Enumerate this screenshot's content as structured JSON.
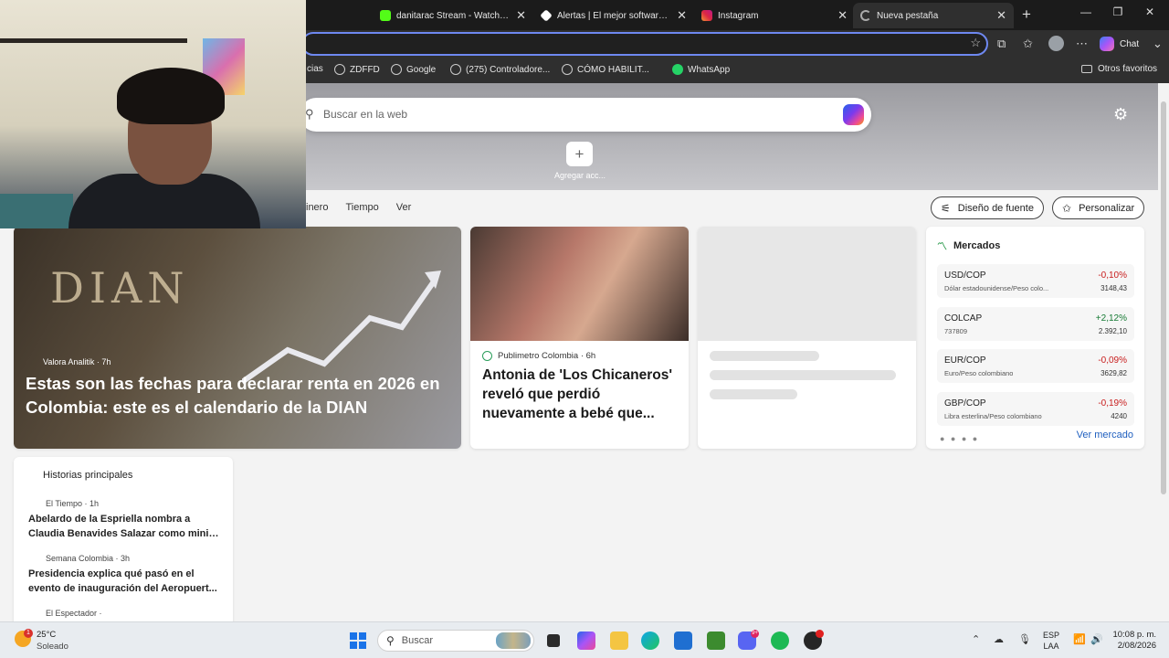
{
  "browser": {
    "tabs": [
      {
        "title": "danitarac Stream - Watch Live",
        "close": "✕",
        "active": false,
        "color": "#53fc18"
      },
      {
        "title": "Alertas | El mejor software para",
        "close": "✕",
        "active": false,
        "color": "#ffffff"
      },
      {
        "title": "Instagram",
        "close": "✕",
        "active": false,
        "color": "#e1306c"
      },
      {
        "title": "Nueva pestaña",
        "close": "✕",
        "active": true,
        "color": "#9aa0a6"
      }
    ],
    "new_tab_symbol": "+",
    "window_controls": {
      "minimize": "—",
      "maximize": "❐",
      "close": "✕"
    },
    "chat_label": "Chat",
    "favorites": [
      {
        "label": "cias",
        "icon": "none"
      },
      {
        "label": "ZDFFD",
        "icon": "globe-icon"
      },
      {
        "label": "Google",
        "icon": "globe-icon"
      },
      {
        "label": "(275) Controladore...",
        "icon": "globe-icon"
      },
      {
        "label": "CÓMO HABILIT...",
        "icon": "globe-icon"
      },
      {
        "label": "WhatsApp",
        "icon": "whatsapp-icon"
      }
    ],
    "other_favorites": "Otros favoritos"
  },
  "ntp": {
    "search_placeholder": "Buscar en la web",
    "add_shortcut": "Agregar acc...",
    "nav": [
      "inero",
      "Tiempo",
      "Ver"
    ],
    "font_design_btn": "Diseño de fuente",
    "personalize_btn": "Personalizar",
    "hero": {
      "source": "Valora Analitik · 7h",
      "title": "Estas son las fechas para declarar renta en 2026 en Colombia: este es el calendario de la DIAN",
      "logo_text": "DIAN"
    },
    "card2": {
      "source": "Publimetro Colombia · 6h",
      "title": "Antonia de 'Los Chicaneros' reveló que perdió nuevamente a bebé que..."
    },
    "markets": {
      "title": "Mercados",
      "rows": [
        {
          "symbol": "USD/COP",
          "name": "Dólar estadounidense/Peso colo...",
          "change": "-0,10%",
          "value": "3148,43",
          "dir": "neg"
        },
        {
          "symbol": "COLCAP",
          "name": "737809",
          "change": "+2,12%",
          "value": "2.392,10",
          "dir": "pos"
        },
        {
          "symbol": "EUR/COP",
          "name": "Euro/Peso colombiano",
          "change": "-0,09%",
          "value": "3629,82",
          "dir": "neg"
        },
        {
          "symbol": "GBP/COP",
          "name": "Libra esterlina/Peso colombiano",
          "change": "-0,19%",
          "value": "4240",
          "dir": "neg"
        }
      ],
      "see_more": "Ver mercado"
    },
    "stories": {
      "title": "Historias principales",
      "items": [
        {
          "source": "El Tiempo · 1h",
          "title_line1": "Abelardo de la Espriella nombra a",
          "title_line2": "Claudia Benavides Salazar como minist..."
        },
        {
          "source": "Semana Colombia · 3h",
          "title_line1": "Presidencia explica qué pasó en el",
          "title_line2": "evento de inauguración del Aeropuert..."
        },
        {
          "source": "El Espectador ·"
        }
      ]
    }
  },
  "taskbar": {
    "weather_temp": "25°C",
    "weather_desc": "Soleado",
    "weather_badge": "1",
    "search_label": "Buscar",
    "lang_line1": "ESP",
    "lang_line2": "LAA",
    "time": "10:08 p. m.",
    "date": "2/08/2026",
    "discord_badge": "9+"
  }
}
